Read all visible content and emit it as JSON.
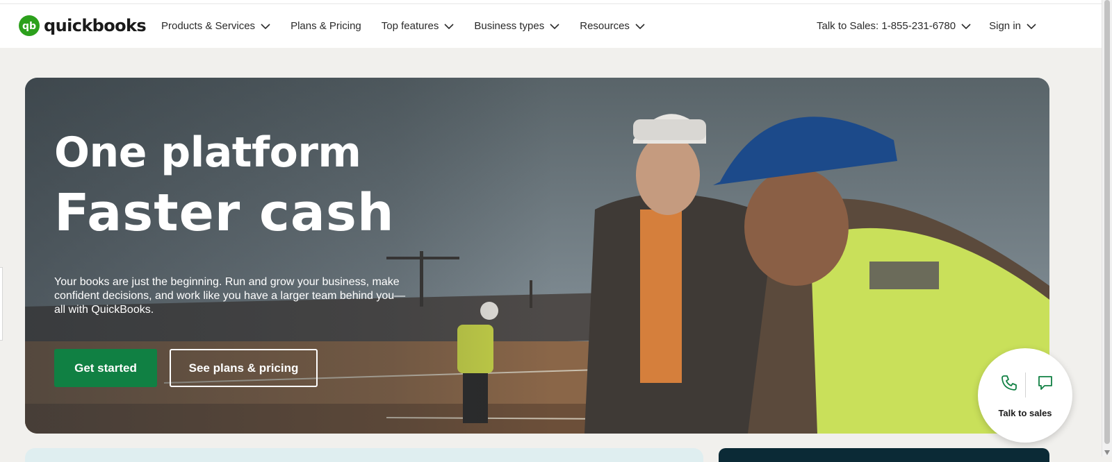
{
  "brand": {
    "name": "quickbooks",
    "logo_glyph": "qb",
    "accent": "#2ca01c"
  },
  "nav": {
    "items": [
      {
        "label": "Products & Services",
        "has_dropdown": true
      },
      {
        "label": "Plans & Pricing",
        "has_dropdown": false
      },
      {
        "label": "Top features",
        "has_dropdown": true
      },
      {
        "label": "Business types",
        "has_dropdown": true
      },
      {
        "label": "Resources",
        "has_dropdown": true
      }
    ],
    "sales_phone": "Talk to Sales: 1-855-231-6780",
    "sign_in": "Sign in"
  },
  "hero": {
    "title_line1": "One platform",
    "title_line2": "Faster cash",
    "subtitle": "Your books are just the beginning. Run and grow your business, make confident decisions, and work like you have a larger team behind you—all with QuickBooks.",
    "primary_cta": "Get started",
    "secondary_cta": "See plans & pricing",
    "primary_color": "#108043",
    "image_subject": "construction workers in hard hats on a rooftop"
  },
  "talk_widget": {
    "label": "Talk to sales",
    "icons": [
      "phone-icon",
      "chat-icon"
    ],
    "icon_color": "#108043"
  }
}
